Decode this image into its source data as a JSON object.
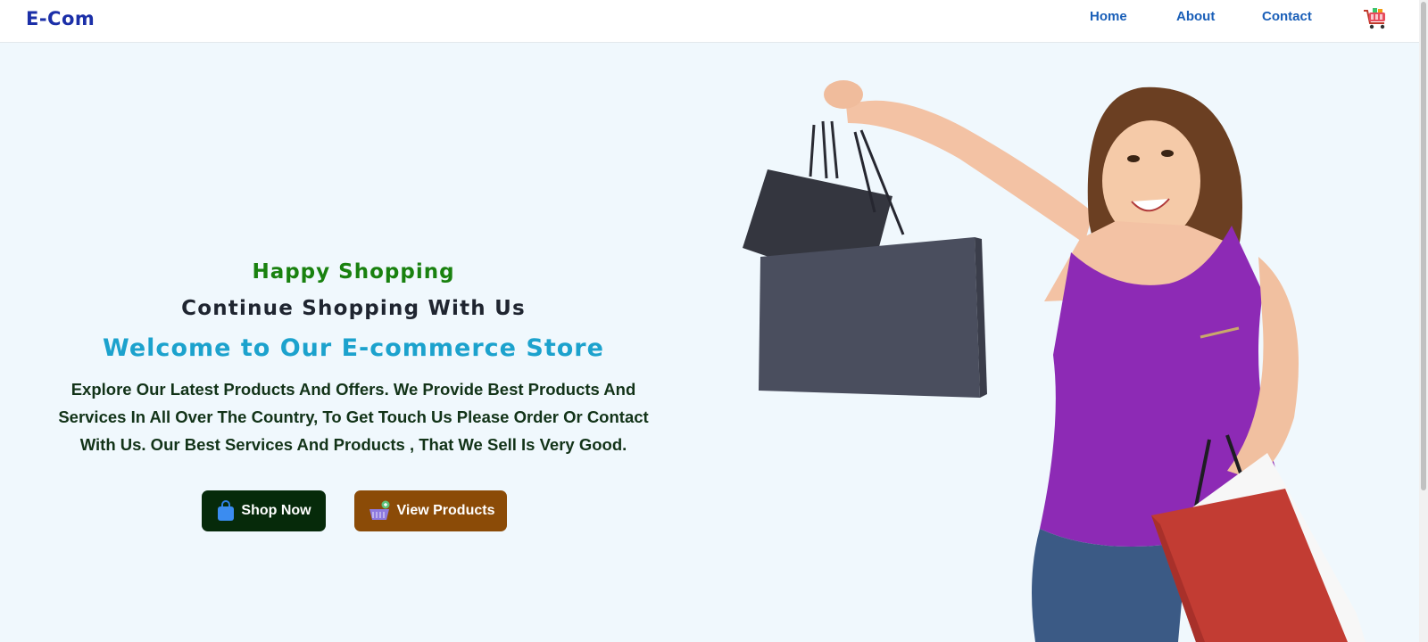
{
  "nav": {
    "brand": "E-Com",
    "links": [
      "Home",
      "About",
      "Contact"
    ],
    "cart_icon": "cart-icon"
  },
  "hero": {
    "eyebrow": "Happy Shopping",
    "subtitle": "Continue Shopping With Us",
    "title": "Welcome to Our E-commerce Store",
    "description": "Explore Our Latest Products And Offers. We Provide Best Products And Services In All Over The Country, To Get Touch Us Please Order Or Contact With Us. Our Best Services And Products , That We Sell Is Very Good.",
    "buttons": {
      "shop_now": "Shop Now",
      "view_products": "View Products"
    }
  },
  "colors": {
    "brand": "#1b2fa8",
    "nav_link": "#1a5fb8",
    "eyebrow": "#19810f",
    "welcome": "#1ca2cd",
    "shop_button": "#062a0a",
    "view_button": "#8b4b07",
    "background": "#f0f8fd"
  }
}
